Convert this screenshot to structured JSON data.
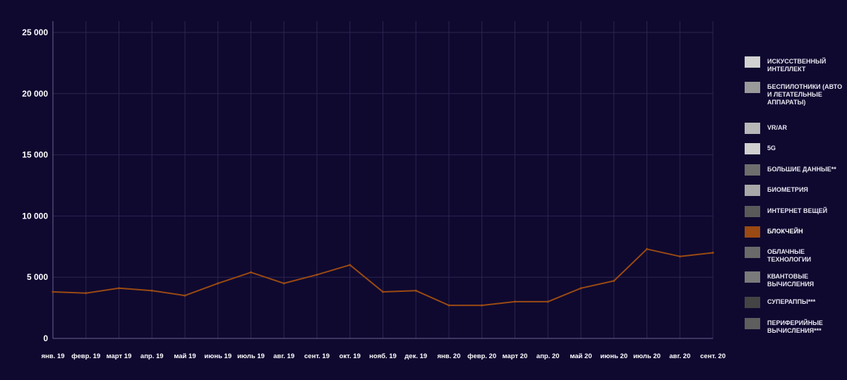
{
  "chart_data": {
    "type": "line",
    "x": [
      "янв. 19",
      "февр. 19",
      "март 19",
      "апр. 19",
      "май 19",
      "июнь 19",
      "июль 19",
      "авг. 19",
      "сент. 19",
      "окт. 19",
      "нояб. 19",
      "дек. 19",
      "янв. 20",
      "февр. 20",
      "март 20",
      "апр. 20",
      "май 20",
      "июнь 20",
      "июль 20",
      "авг. 20",
      "сент. 20"
    ],
    "series": [
      {
        "name": "БЛОКЧЕЙН",
        "color": "#9a4a12",
        "values": [
          3800,
          3700,
          4100,
          3900,
          3500,
          4500,
          5400,
          4500,
          5200,
          6000,
          3800,
          3900,
          2700,
          2700,
          3000,
          3000,
          4100,
          4700,
          7300,
          6700,
          7000
        ]
      }
    ],
    "y_ticks": [
      {
        "value": 0,
        "label": "0"
      },
      {
        "value": 5000,
        "label": "5 000"
      },
      {
        "value": 10000,
        "label": "10 000"
      },
      {
        "value": 15000,
        "label": "15 000"
      },
      {
        "value": 20000,
        "label": "20 000"
      },
      {
        "value": 25000,
        "label": "25 000"
      }
    ],
    "ylim": [
      0,
      25000
    ],
    "grid": true,
    "legend_position": "right",
    "legend": [
      {
        "label": "ИСКУССТВЕННЫЙ ИНТЕЛЛЕКТ",
        "color": "#d2d2d2",
        "highlight": false
      },
      {
        "label": "БЕСПИЛОТНИКИ (АВТО И ЛЕТАТЕЛЬНЫЕ АППАРАТЫ)",
        "color": "#9a9a9a",
        "highlight": false
      },
      {
        "label": "VR/AR",
        "color": "#b8b8b8",
        "highlight": false
      },
      {
        "label": "5G",
        "color": "#d0d0d0",
        "highlight": false
      },
      {
        "label": "БОЛЬШИЕ ДАННЫЕ**",
        "color": "#6e6e6e",
        "highlight": false
      },
      {
        "label": "БИОМЕТРИЯ",
        "color": "#a8a8a8",
        "highlight": false
      },
      {
        "label": "ИНТЕРНЕТ ВЕЩЕЙ",
        "color": "#5a5a5a",
        "highlight": false
      },
      {
        "label": "БЛОКЧЕЙН",
        "color": "#9a4a12",
        "highlight": true
      },
      {
        "label": "ОБЛАЧНЫЕ ТЕХНОЛОГИИ",
        "color": "#6a6a6a",
        "highlight": false
      },
      {
        "label": "КВАНТОВЫЕ ВЫЧИСЛЕНИЯ",
        "color": "#7a7a7a",
        "highlight": false
      },
      {
        "label": "СУПЕРАППЫ***",
        "color": "#444444",
        "highlight": false
      },
      {
        "label": "ПЕРИФЕРИЙНЫЕ ВЫЧИСЛЕНИЯ***",
        "color": "#5e5e5e",
        "highlight": false
      }
    ]
  }
}
